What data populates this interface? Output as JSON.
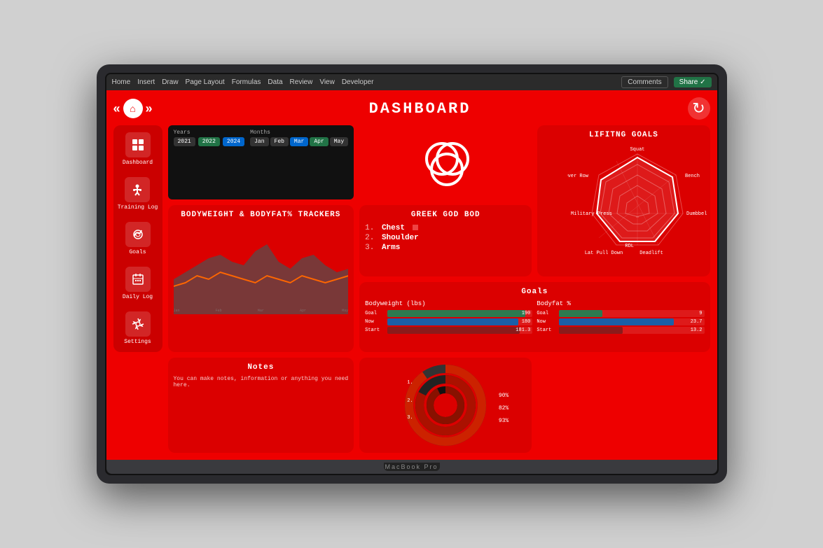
{
  "excel": {
    "menu_items": [
      "Home",
      "Insert",
      "Draw",
      "Page Layout",
      "Formulas",
      "Data",
      "Review",
      "View",
      "Developer"
    ],
    "comments_label": "Comments",
    "share_label": "Share ✓"
  },
  "header": {
    "back_arrow": "«",
    "home_symbol": "⌂",
    "forward_arrow": "»",
    "title": "DASHBOARD",
    "refresh_symbol": "↻"
  },
  "filter": {
    "years_label": "Years",
    "months_label": "Months",
    "years": [
      "2021",
      "2022",
      "2024"
    ],
    "months": [
      "Jan",
      "Feb",
      "Mar",
      "Apr",
      "May"
    ]
  },
  "sidebar": {
    "items": [
      {
        "label": "Dashboard",
        "icon": "📊"
      },
      {
        "label": "Training Log",
        "icon": "🏋"
      },
      {
        "label": "Goals",
        "icon": "💪"
      },
      {
        "label": "Daily Log",
        "icon": "📅"
      },
      {
        "label": "Settings",
        "icon": "⚙"
      }
    ]
  },
  "lifting_goals": {
    "title": "LIFITNG GOALS",
    "labels": [
      "Squat",
      "Bench",
      "Dumbbell Press",
      "Military Press",
      "Deadlift",
      "Lat Pull Down",
      "RDL",
      "Bent Over Row"
    ]
  },
  "bodyweight_tracker": {
    "title": "BODYWEIGHT & BODYFAT% TRACKERS"
  },
  "greek_god": {
    "title": "GREEK GOD BOD",
    "items": [
      {
        "rank": "1.",
        "name": "Chest"
      },
      {
        "rank": "2.",
        "name": "Shoulder"
      },
      {
        "rank": "3.",
        "name": "Arms"
      }
    ]
  },
  "notes": {
    "title": "Notes",
    "text": "You can make notes, information or anything you need here."
  },
  "donut": {
    "values": [
      {
        "label": "90%",
        "color": "#333",
        "size": 85
      },
      {
        "label": "82%",
        "color": "#cc0000",
        "size": 65
      },
      {
        "label": "93%",
        "color": "#555",
        "size": 45
      }
    ]
  },
  "goals": {
    "title": "Goals",
    "bodyweight": {
      "label": "Bodyweight (lbs)",
      "bars": [
        {
          "name": "Goal",
          "value": 190,
          "max": 200,
          "color": "#2d7a4f",
          "display": "190"
        },
        {
          "name": "Now",
          "value": 180,
          "max": 200,
          "color": "#1a5fa8",
          "display": "180"
        },
        {
          "name": "Start",
          "value": 181,
          "max": 200,
          "color": "#8b1a1a",
          "display": "181.3"
        }
      ]
    },
    "bodyfat": {
      "label": "Bodyfat %",
      "bars": [
        {
          "name": "Goal",
          "value": 9,
          "max": 30,
          "color": "#2d7a4f",
          "display": "9"
        },
        {
          "name": "Now",
          "value": 23.7,
          "max": 30,
          "color": "#1a5fa8",
          "display": "23.7"
        },
        {
          "name": "Start",
          "value": 13.2,
          "max": 30,
          "color": "#8b1a1a",
          "display": "13.2"
        }
      ]
    }
  },
  "macbook_label": "MacBook Pro"
}
